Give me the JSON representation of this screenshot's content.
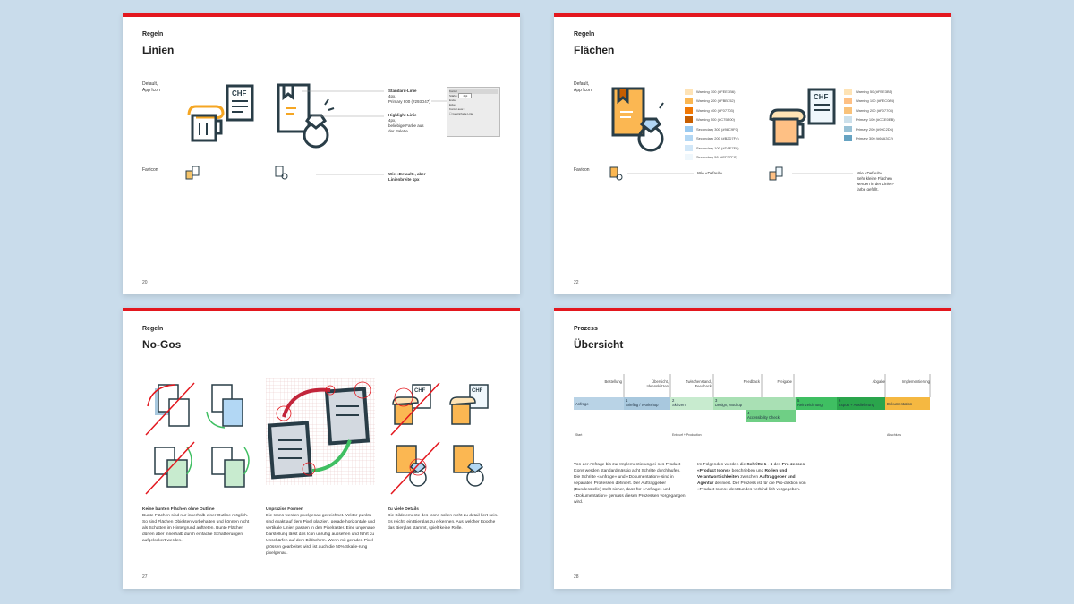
{
  "pages": [
    {
      "kicker": "Regeln",
      "title": "Linien",
      "page_number": "20",
      "row_default": "Default,\nApp Icon",
      "row_favicon": "Favicon",
      "standard_title": "Standard-Linie",
      "standard_body": "4px,\nPrimary 900 (#293D47)",
      "highlight_title": "Highlight-Linie",
      "highlight_body": "4px,\nbeliebige Farbe aus\nder Palette",
      "favicon_note": "Wie «Default», aber\nLinienbreite 1px",
      "chf": "CHF",
      "panel": {
        "title": "Kontur",
        "weight_label": "Stärke:",
        "weight_value": "4 pt",
        "cap_label": "Ende:",
        "corner_label": "Ecke:",
        "align_label": "Kontur ausr.:",
        "dashed_label": "Gestrichelte Linie"
      }
    },
    {
      "kicker": "Regeln",
      "title": "Flächen",
      "page_number": "22",
      "row_default": "Default,\nApp Icon",
      "row_favicon": "Favicon",
      "favicon_note_left": "Wie «Default»",
      "favicon_note_right": "Wie «Default»\nSehr kleine Flächen\nwerden in der Linien-\nfarbe gefüllt.",
      "chf": "CHF",
      "swatches_left": [
        {
          "label": "Warning 100 (#FEE3B6)",
          "color": "#fee3b6"
        },
        {
          "label": "Warning 200 (#FBB752)",
          "color": "#fbb752"
        },
        {
          "label": "Warning 400 (#F07703)",
          "color": "#f07703"
        },
        {
          "label": "Warning 500 (#C75E00)",
          "color": "#c75e00"
        },
        {
          "label": "Secondary 300 (#98C9F0)",
          "color": "#98c9f0"
        },
        {
          "label": "Secondary 200 (#B2D7F4)",
          "color": "#b2d7f4"
        },
        {
          "label": "Secondary 100 (#D1E7F8)",
          "color": "#d1e7f8"
        },
        {
          "label": "Secondary 50 (#EFF7FC)",
          "color": "#eff7fc"
        }
      ],
      "swatches_right": [
        {
          "label": "Warning 50 (#FEE3B5)",
          "color": "#fee3b5"
        },
        {
          "label": "Warning 100 (#FEC084)",
          "color": "#fec084"
        },
        {
          "label": "Warning 200 (#F07703)",
          "color": "#f9c27a"
        },
        {
          "label": "Primary 100 (#CCE0EB)",
          "color": "#cce0eb"
        },
        {
          "label": "Primary 200 (#99C2D6)",
          "color": "#99c2d6"
        },
        {
          "label": "Primary 300 (#66A3C2)",
          "color": "#66a3c2"
        }
      ]
    },
    {
      "kicker": "Regeln",
      "title": "No-Gos",
      "page_number": "27",
      "chf": "CHF",
      "columns": [
        {
          "heading": "Keine bunten Flächen ohne Outline",
          "body": "Bunte Flächen sind nur innerhalb einer Outline möglich. So sind Flächen Objekten vorbehalten und können nicht als Schatten im Hintergrund auftreten. Bunte Flächen dürfen aber innerhalb durch einfache Schattierungen aufgelockert werden."
        },
        {
          "heading": "Unpräzise Formen",
          "body": "Die Icons werden pixelgenau gezeichnet. Vektor-punkte sind exakt auf dem Pixel platziert, gerade horizontale und vertikale Linien passen in den Pixelraster. Eine ungenaue Darstellung lässt das Icon unruhig aussehen und führt zu Unschärfen auf dem Bildschirm. Wenn mit geraden Pixel-grössen gearbeitet wird, ist auch die 50% Skalie-rung pixelgenau."
        },
        {
          "heading": "Zu viele Details",
          "body": "Die Bildelemente des Icons sollen nicht zu detail-liert sein. Es reicht, ein Bierglas zu erkennen. Aus welcher Epoche das Bierglas stammt, spielt keine Rolle."
        }
      ]
    },
    {
      "kicker": "Prozess",
      "title": "Übersicht",
      "page_number": "28",
      "milestones": [
        "Bestellung",
        "Übersicht,\nIdeenskizzen",
        "Zwischenstand,\nFeedback",
        "Feedback",
        "Freigabe",
        "Abgabe",
        "Implementierung"
      ],
      "bars": [
        {
          "label": "Anfrage",
          "color": "#b9d3e6"
        },
        {
          "label": "1\nBriefing / Workshop",
          "color": "#a8c8de"
        },
        {
          "label": "2\nSkizzen",
          "color": "#c8ebcf"
        },
        {
          "label": "3\nDesign, Mockup",
          "color": "#a9e0b4"
        },
        {
          "label": "4\nAccessibility Check",
          "color": "#6fcf85"
        },
        {
          "label": "5\nReinzeichnung",
          "color": "#3fbf62"
        },
        {
          "label": "6\nExport + Auslieferung",
          "color": "#2aa54c"
        },
        {
          "label": "Dokumentation",
          "color": "#f5b841"
        }
      ],
      "phases": [
        "Start",
        "Entwurf + Produktion",
        "Abschluss"
      ],
      "text_left": "Von der Anfrage bis zur Implementierung ei-nes Product Icons werden standardmässig acht Schritte durchlaufen. Die Schritte «Anfrage» und «Dokumentation» sind in separaten Prozessen definiert. Der Auftraggeber (Bundesstelle) stellt sicher, dass für «Anfrage» und «Dokumentation» gemäss diesen Prozessen vorgegangen wird.",
      "text_right_1": "Im Folgenden werden die ",
      "text_right_b1": "Schritte 1 - 6",
      "text_right_2": " des ",
      "text_right_b2": "Pro-zesses «Product Icons»",
      "text_right_3": " beschrieben und ",
      "text_right_b3": "Rollen und Verantwortlichkeiten",
      "text_right_4": " zwischen ",
      "text_right_b4": "Auftraggeber und Agentur",
      "text_right_5": " definiert. Der Prozess ist für die Pro-duktion von «Product Icons» des Bundes verbind-lich vorgegeben."
    }
  ],
  "colors": {
    "brand_red": "#e3171e",
    "line": "#293d47",
    "orange": "#f5a623",
    "background": "#c9dceb"
  }
}
